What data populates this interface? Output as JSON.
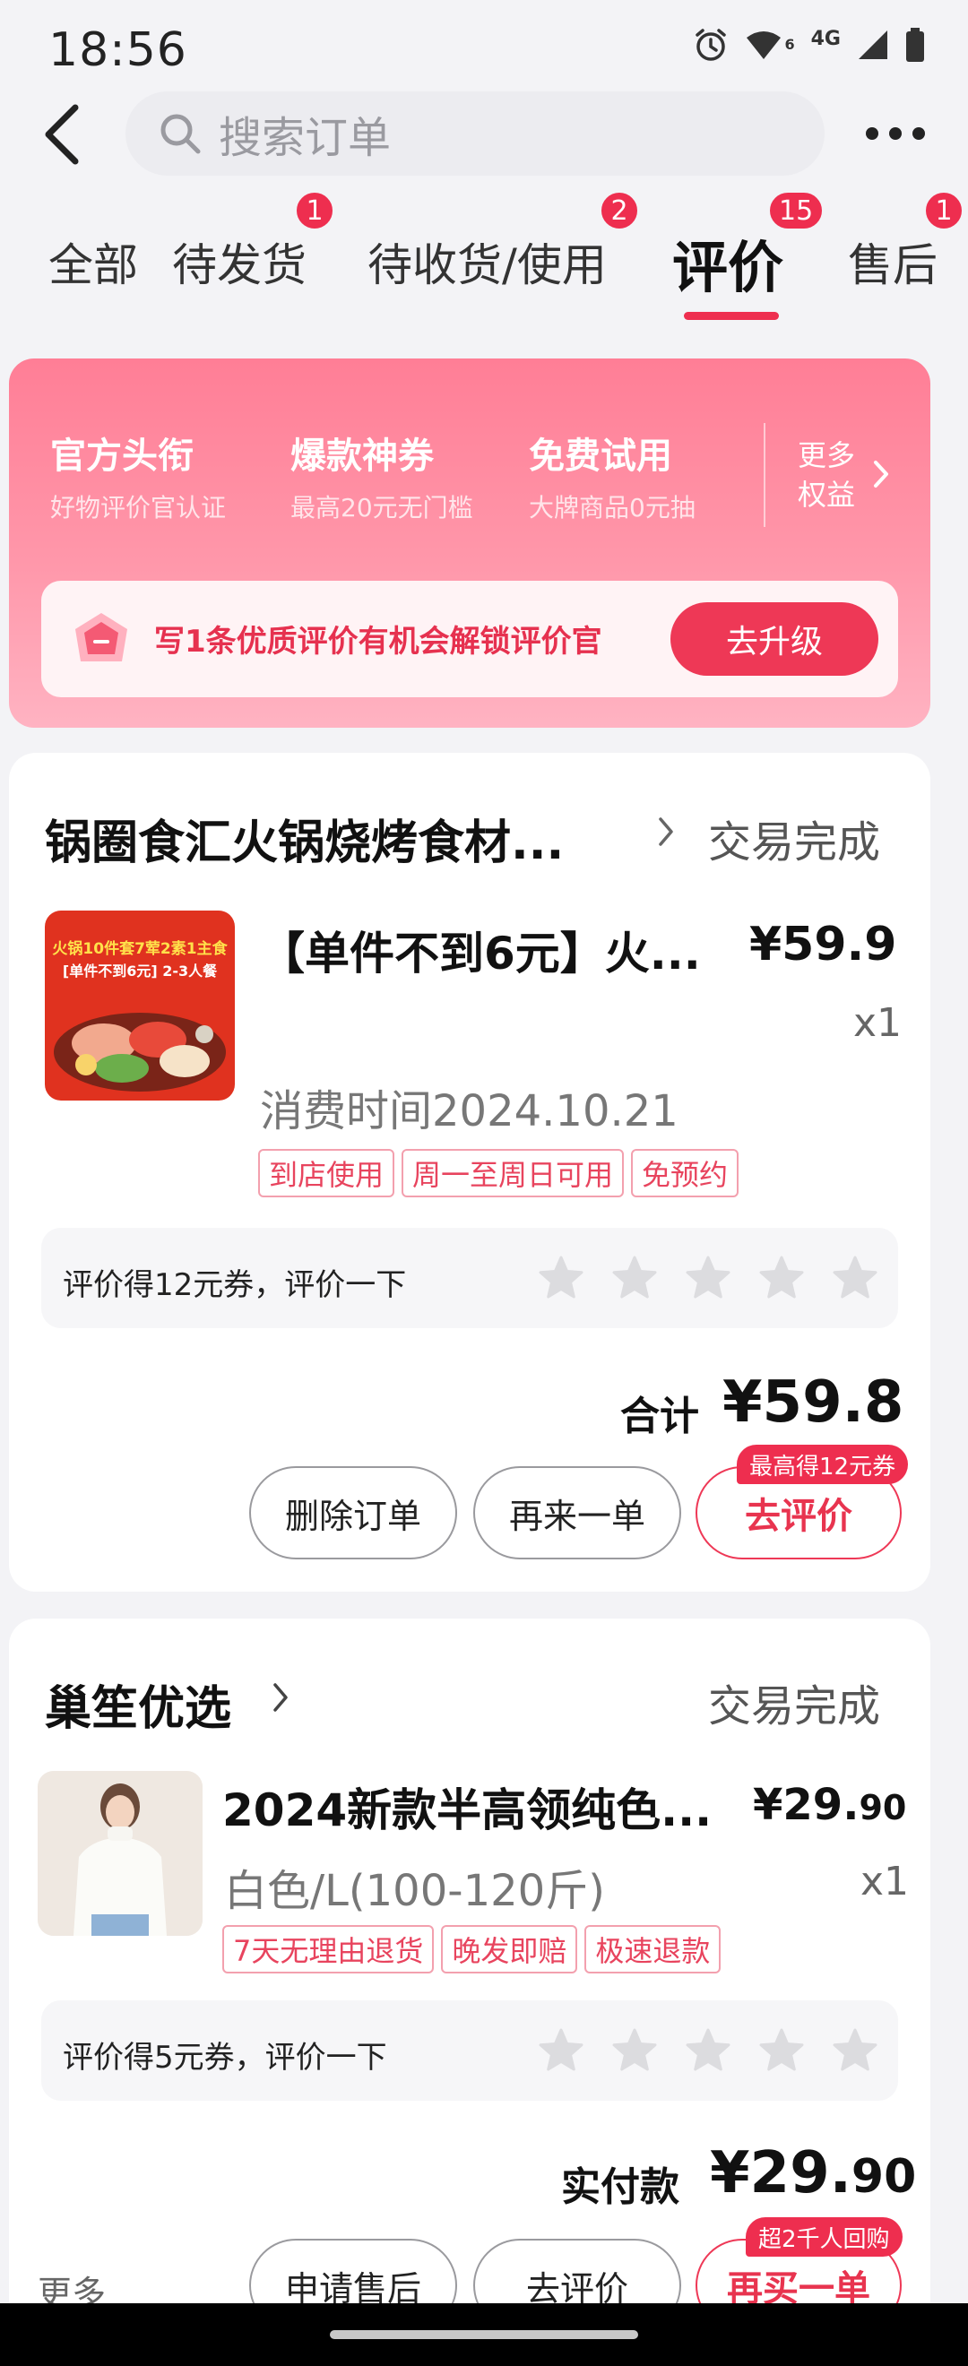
{
  "status_bar": {
    "time": "18:56",
    "network": "4G",
    "signal_sup": "6"
  },
  "header": {
    "search_placeholder": "搜索订单"
  },
  "tabs": [
    {
      "label": "全部",
      "badge": ""
    },
    {
      "label": "待发货",
      "badge": "1"
    },
    {
      "label": "待收货/使用",
      "badge": "2"
    },
    {
      "label": "评价",
      "badge": "15",
      "active": true
    },
    {
      "label": "售后",
      "badge": "1"
    }
  ],
  "banner": {
    "benefits": [
      {
        "title": "官方头衔",
        "subtitle": "好物评价官认证"
      },
      {
        "title": "爆款神券",
        "subtitle": "最高20元无门槛"
      },
      {
        "title": "免费试用",
        "subtitle": "大牌商品0元抽"
      }
    ],
    "more_line1": "更多",
    "more_line2": "权益",
    "upgrade_text": "写1条优质评价有机会解锁评价官",
    "upgrade_button": "去升级"
  },
  "orders": [
    {
      "store": "锅圈食汇火锅烧烤食材...",
      "status": "交易完成",
      "image_text_line1": "火锅10件套7荤2素1主食",
      "image_text_line2": "[单件不到6元] 2-3人餐",
      "product_title": "【单件不到6元】火...",
      "price": "¥59.9",
      "qty": "x1",
      "meta": "消费时间2024.10.21",
      "tags": [
        "到店使用",
        "周一至周日可用",
        "免预约"
      ],
      "review_prompt": "评价得12元券，评价一下",
      "total_label": "合计",
      "total_value": "¥59.8",
      "buttons": [
        "删除订单",
        "再来一单",
        "去评价"
      ],
      "button_badge": "最高得12元券"
    },
    {
      "store": "巢笙优选",
      "status": "交易完成",
      "product_title": "2024新款半高领纯色...",
      "price_main": "¥29.",
      "price_decimal": "90",
      "qty": "x1",
      "meta": "白色/L(100-120斤)",
      "tags": [
        "7天无理由退货",
        "晚发即赔",
        "极速退款"
      ],
      "review_prompt": "评价得5元券，评价一下",
      "total_label": "实付款",
      "total_value_main": "¥29.",
      "total_value_decimal": "90",
      "more": "更多",
      "buttons": [
        "申请售后",
        "去评价",
        "再买一单"
      ],
      "button_badge": "超2千人回购"
    }
  ],
  "colors": {
    "accent": "#ee2e4f",
    "banner_top": "#ff7e96",
    "background": "#f3f3f6"
  }
}
